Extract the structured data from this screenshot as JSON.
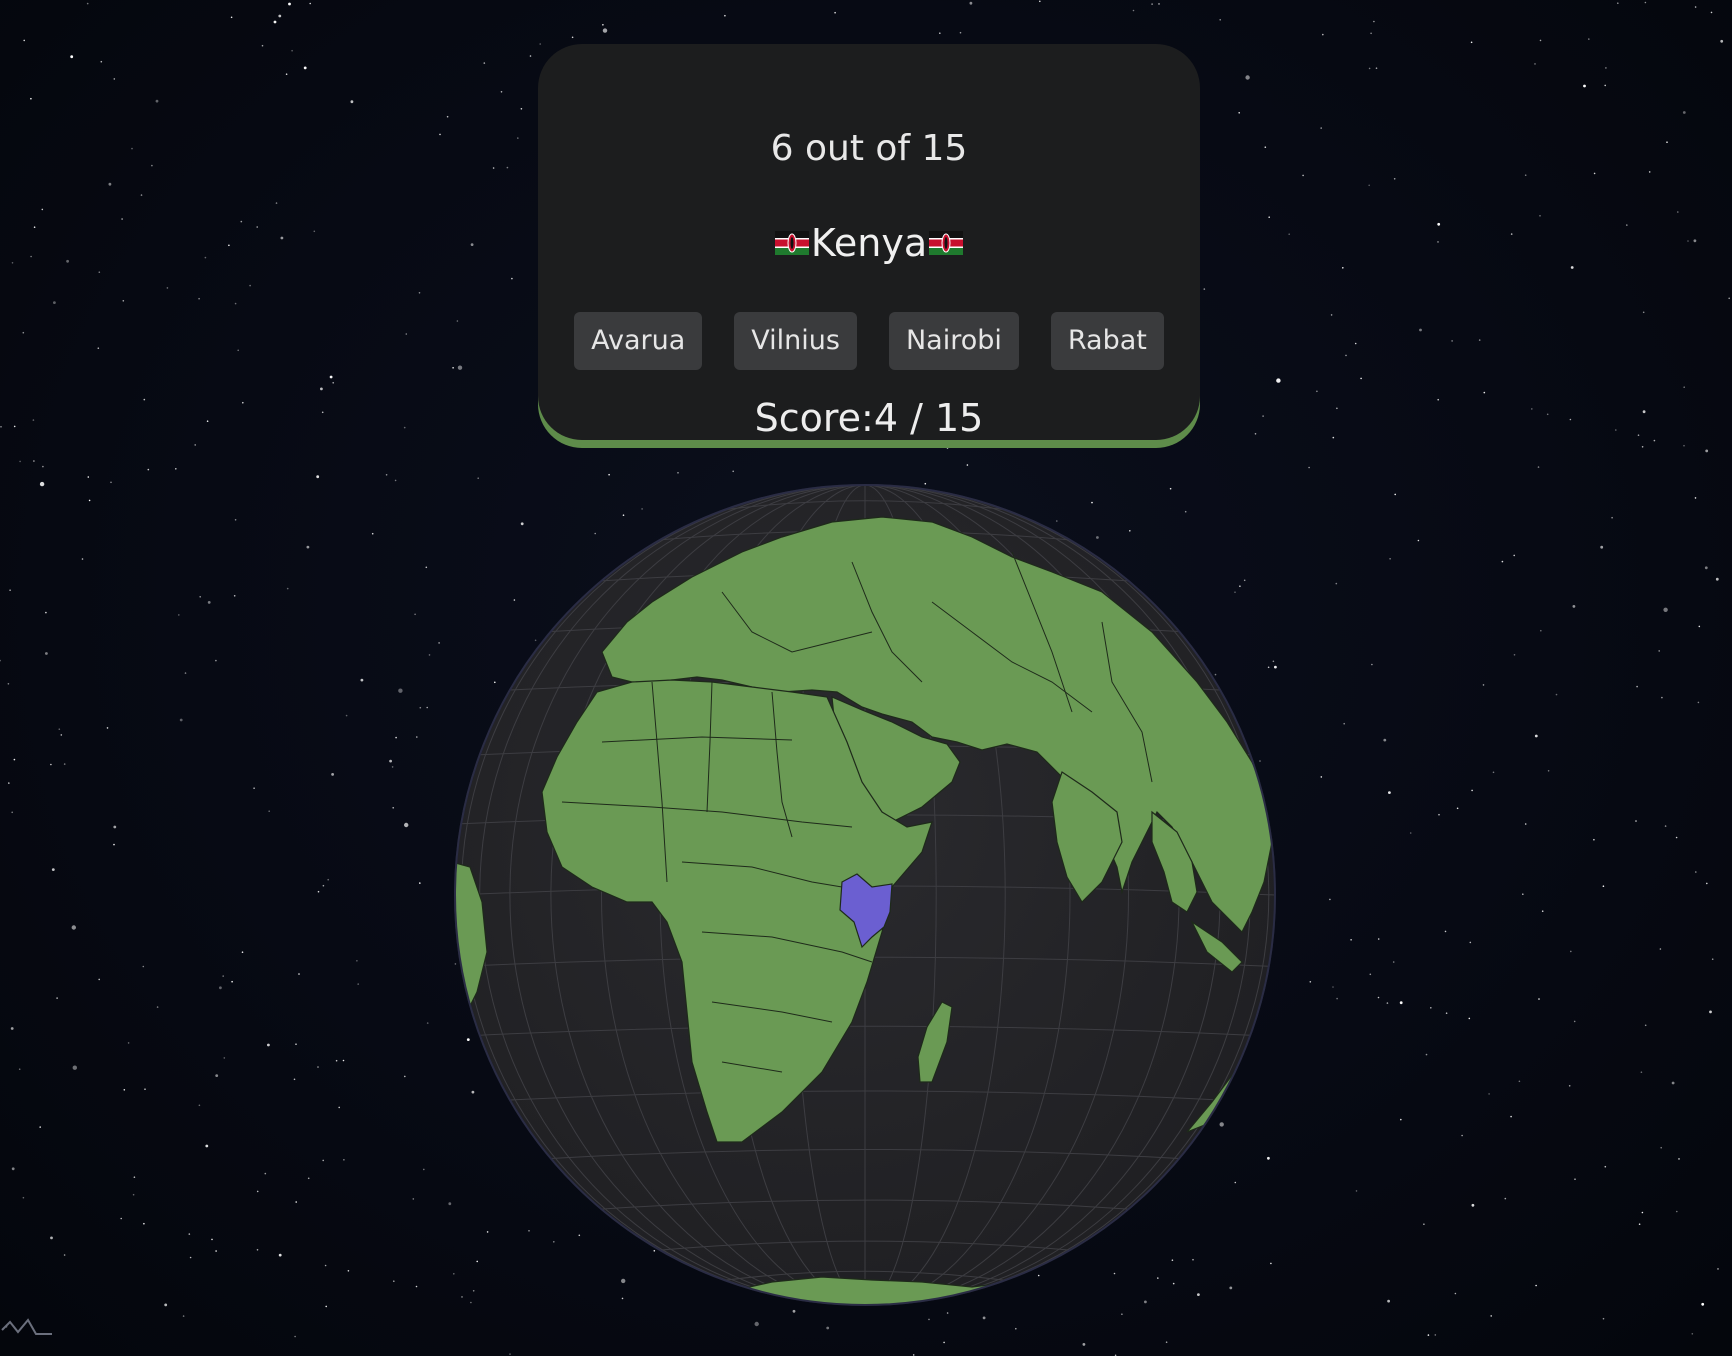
{
  "quiz": {
    "progress": "6 out of 15",
    "country": "Kenya",
    "flag_icon": "kenya-flag-icon",
    "answers": [
      "Avarua",
      "Vilnius",
      "Nairobi",
      "Rabat"
    ],
    "score_label": "Score:",
    "score_value": "4 / 15"
  },
  "globe": {
    "highlighted_country": "Kenya",
    "colors": {
      "land": "#6a9a54",
      "highlight": "#6b5fd1",
      "ocean": "#242427",
      "graticule": "#3d3d42",
      "panel_accent": "#5e8c4a"
    }
  }
}
